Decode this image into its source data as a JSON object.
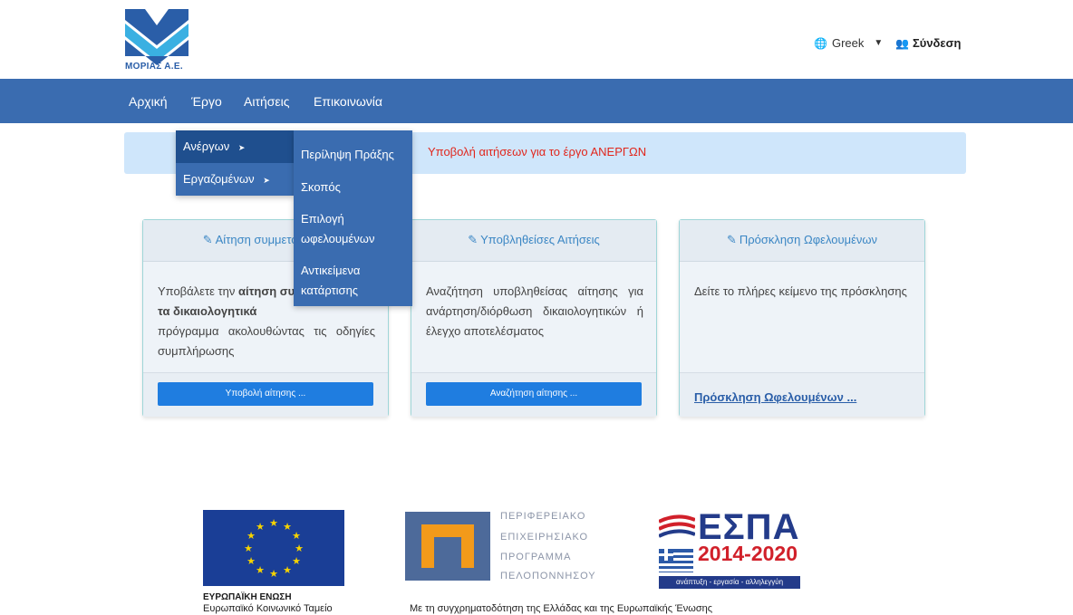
{
  "header": {
    "logo_text": "ΜΟΡΙΑΣ Α.Ε.",
    "language": "Greek",
    "login": "Σύνδεση"
  },
  "nav": {
    "items": [
      "Αρχική",
      "Έργο",
      "Αιτήσεις",
      "Επικοινωνία"
    ]
  },
  "alert": {
    "text": "Υποβολή αιτήσεων για το έργο  ΑΝΕΡΓΩΝ"
  },
  "dropdown": {
    "level1": [
      "Ανέργων",
      "Εργαζομένων"
    ],
    "level2": [
      "Περίληψη Πράξης",
      "Σκοπός",
      "Επιλογή ωφελουμένων",
      "Αντικείμενα κατάρτισης"
    ]
  },
  "cards": [
    {
      "title": "Αίτηση συμμετοχής ω",
      "body_part1": "Υποβάλετε την ",
      "body_bold": "αίτηση συ",
      "body_part2": "",
      "body_bold2": "τα   δικαιολογητικά",
      "body_part3": "πρόγραμμα ακολουθώντας τις οδηγίες συμπλήρωσης",
      "button": "Υποβολή αίτησης ..."
    },
    {
      "title": "Υποβληθείσες Αιτήσεις",
      "body": "Αναζήτηση υποβληθείσας αίτησης για ανάρτηση/διόρθωση δικαιολογητικών ή έλεγχο αποτελέσματος",
      "button": "Αναζήτηση αίτησης ..."
    },
    {
      "title": "Πρόσκληση Ωφελουμένων",
      "body": "Δείτε το πλήρες κείμενο της πρόσκλησης",
      "link": "Πρόσκληση Ωφελουμένων ..."
    }
  ],
  "footer": {
    "eu_title": "ΕΥΡΩΠΑΪΚΗ ΕΝΩΣΗ",
    "eu_fund": "Ευρωπαϊκό Κοινωνικό Ταμείο",
    "pep_lines": [
      "ΠΕΡΙΦΕΡΕΙΑΚΟ",
      "ΕΠΙΧΕΙΡΗΣΙΑΚΟ",
      "ΠΡΟΓΡΑΜΜΑ",
      "ΠΕΛΟΠΟΝΝΗΣΟΥ"
    ],
    "espa_title": "ΕΣΠΑ",
    "espa_years": "2014-2020",
    "espa_tagline": "ανάπτυξη - εργασία - αλληλεγγύη",
    "cofunding": "Με τη συγχρηματοδότηση της Ελλάδας και της Ευρωπαϊκής Ένωσης"
  },
  "colors": {
    "navbar": "#3a6cb0",
    "alert_bg": "#cfe6fb",
    "alert_text": "#e1261c",
    "button": "#1f7de0"
  }
}
